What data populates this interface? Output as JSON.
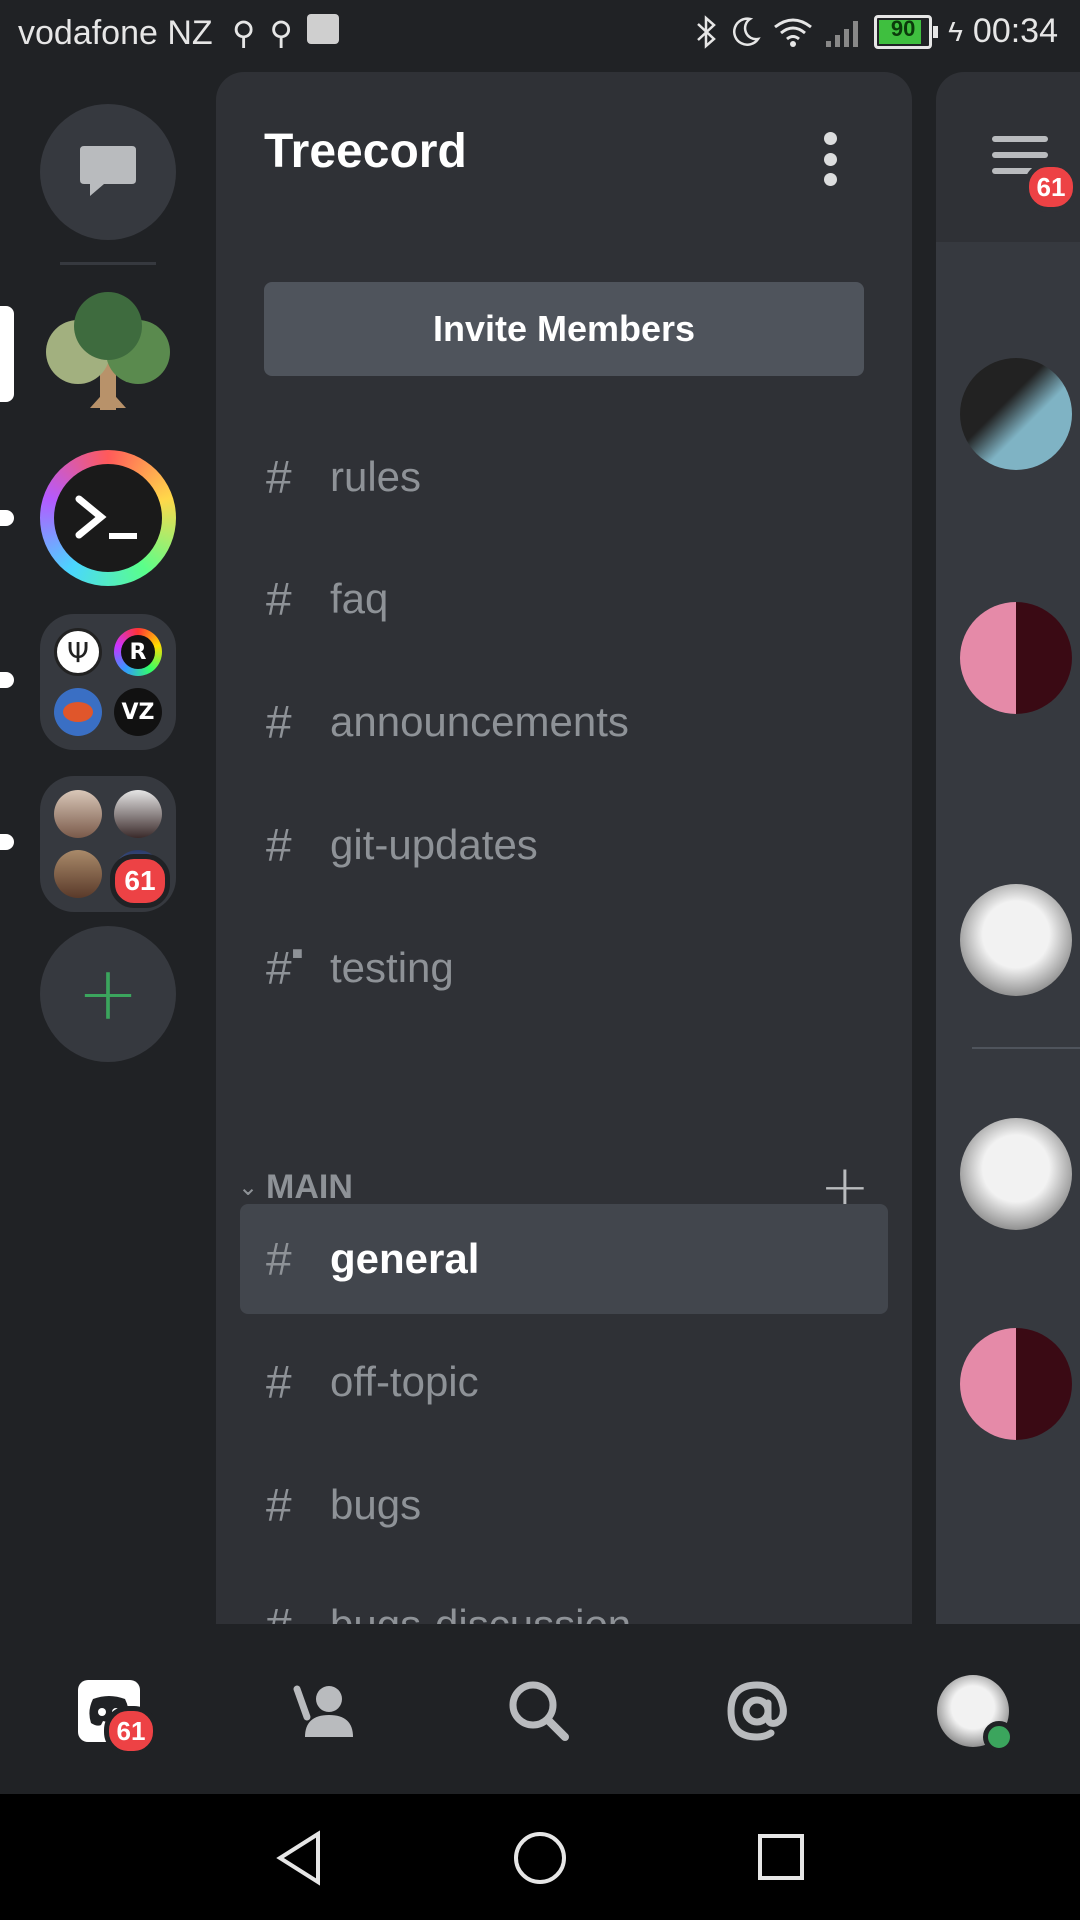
{
  "status_bar": {
    "carrier": "vodafone NZ",
    "battery_level": "90",
    "time": "00:34"
  },
  "server_rail": {
    "unread_badge": "61",
    "add_server_symbol": "+"
  },
  "channel_panel": {
    "server_name": "Treecord",
    "invite_button": "Invite Members",
    "hash_symbol": "#",
    "channels_top": [
      {
        "name": "rules"
      },
      {
        "name": "faq"
      },
      {
        "name": "announcements"
      },
      {
        "name": "git-updates"
      },
      {
        "name": "testing",
        "locked": true
      }
    ],
    "category": {
      "name": "MAIN",
      "add_symbol": "+"
    },
    "channels_main": [
      {
        "name": "general",
        "selected": true
      },
      {
        "name": "off-topic"
      },
      {
        "name": "bugs"
      },
      {
        "name": "bugs-discussion"
      }
    ]
  },
  "member_strip": {
    "badge": "61"
  },
  "bottom_tabs": {
    "home_badge": "61",
    "icons": [
      "discord-home-icon",
      "friends-icon",
      "search-icon",
      "mentions-icon",
      "profile-avatar"
    ]
  },
  "colors": {
    "background": "#202225",
    "panel": "#2f3136",
    "selected": "#42464d",
    "badge": "#ed4245",
    "add_green": "#3ba55d",
    "online": "#3ba55d"
  }
}
